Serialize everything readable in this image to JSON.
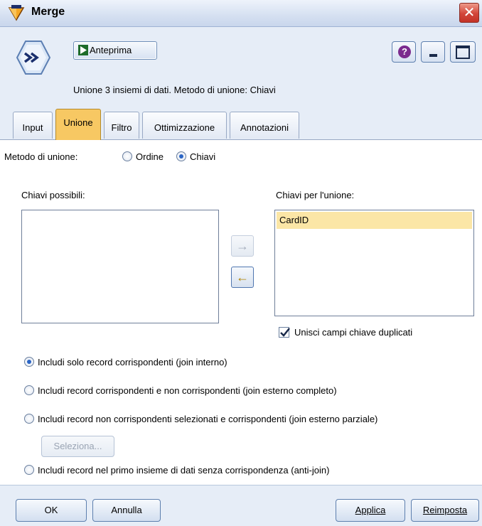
{
  "window": {
    "title": "Merge",
    "close_glyph": "✕"
  },
  "header": {
    "preview_label": "Anteprima",
    "help_glyph": "?",
    "description": "Unione 3 insiemi di dati. Metodo di unione: Chiavi"
  },
  "tabs": [
    {
      "label": "Input",
      "active": false
    },
    {
      "label": "Unione",
      "active": true
    },
    {
      "label": "Filtro",
      "active": false
    },
    {
      "label": "Ottimizzazione",
      "active": false
    },
    {
      "label": "Annotazioni",
      "active": false
    }
  ],
  "merge": {
    "method_label": "Metodo di unione:",
    "options": [
      {
        "label": "Ordine",
        "selected": false
      },
      {
        "label": "Chiavi",
        "selected": true
      }
    ],
    "possible_keys_label": "Chiavi possibili:",
    "possible_keys": [],
    "merge_keys_label": "Chiavi per l'unione:",
    "merge_keys": [
      "CardID"
    ],
    "move_right_glyph": "→",
    "move_left_glyph": "←",
    "combine_duplicates_label": "Unisci campi chiave duplicati",
    "combine_duplicates_checked": true,
    "join_options": [
      {
        "label": "Includi solo record corrispondenti (join interno)",
        "selected": true
      },
      {
        "label": "Includi record corrispondenti e non corrispondenti (join esterno completo)",
        "selected": false
      },
      {
        "label": "Includi record non corrispondenti selezionati e corrispondenti (join esterno parziale)",
        "selected": false
      },
      {
        "label": "Includi record nel primo insieme di dati senza corrispondenza (anti-join)",
        "selected": false
      }
    ],
    "select_button_label": "Seleziona..."
  },
  "footer": {
    "ok_label": "OK",
    "cancel_label": "Annulla",
    "apply_label": "Applica",
    "reset_label": "Reimposta"
  },
  "colors": {
    "active_tab": "#f7c863",
    "selected_item": "#fbe6a6",
    "panel_bg": "#e6edf7"
  }
}
